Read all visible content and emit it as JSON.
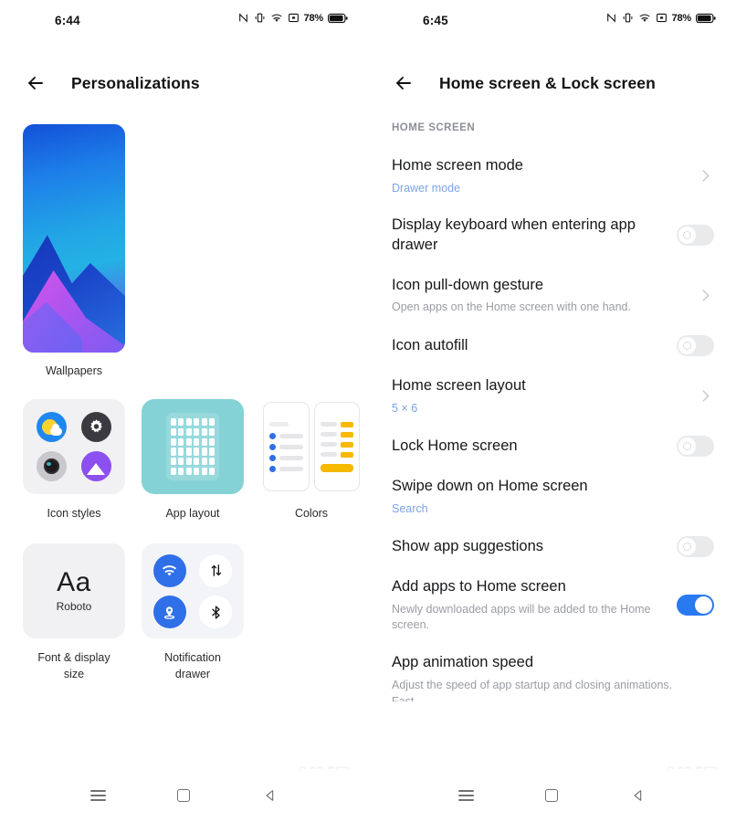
{
  "left": {
    "status": {
      "time": "6:44",
      "battery_percent": "78%",
      "icons": [
        "nfc-icon",
        "vibrate-icon",
        "wifi-icon",
        "screen-record-icon",
        "battery-icon"
      ]
    },
    "appbar": {
      "title": "Personalizations",
      "back": "back-arrow-icon"
    },
    "cards": {
      "wallpapers": {
        "label": "Wallpapers"
      },
      "icon_styles": {
        "label": "Icon styles",
        "icons": [
          "weather-icon",
          "settings-gear-icon",
          "camera-icon",
          "gallery-icon"
        ]
      },
      "app_layout": {
        "label": "App layout",
        "grid_cols": 6,
        "grid_rows": 6
      },
      "colors": {
        "label": "Colors",
        "accent": "#f6b900",
        "secondary": "#2f6fe8"
      },
      "font_display": {
        "label_line1": "Font & display",
        "label_line2": "size",
        "sample": "Aa",
        "font_name": "Roboto"
      },
      "notification_drawer": {
        "label_line1": "Notification",
        "label_line2": "drawer",
        "toggles": [
          "wifi-icon",
          "mobile-data-icon",
          "location-icon",
          "bluetooth-icon"
        ],
        "active": [
          "wifi-icon",
          "location-icon"
        ]
      }
    },
    "navbar": [
      "recents-icon",
      "home-icon",
      "back-icon"
    ],
    "watermark_line1": "NYP",
    "watermark_line2": "GKS"
  },
  "right": {
    "status": {
      "time": "6:45",
      "battery_percent": "78%",
      "icons": [
        "nfc-icon",
        "vibrate-icon",
        "wifi-icon",
        "screen-record-icon",
        "battery-icon"
      ]
    },
    "appbar": {
      "title": "Home screen & Lock screen",
      "back": "back-arrow-icon"
    },
    "section_header": "HOME SCREEN",
    "rows": [
      {
        "title": "Home screen mode",
        "value": "Drawer mode",
        "control": "chevron"
      },
      {
        "title": "Display keyboard when entering app drawer",
        "control": "toggle",
        "toggle_on": false
      },
      {
        "title": "Icon pull-down gesture",
        "sub": "Open apps on the Home screen with one hand.",
        "control": "chevron"
      },
      {
        "title": "Icon autofill",
        "control": "toggle",
        "toggle_on": false
      },
      {
        "title": "Home screen layout",
        "value": "5 × 6",
        "control": "chevron"
      },
      {
        "title": "Lock Home screen",
        "control": "toggle",
        "toggle_on": false
      },
      {
        "title": "Swipe down on Home screen",
        "value": "Search",
        "control": "chevron"
      },
      {
        "title": "Show app suggestions",
        "control": "toggle",
        "toggle_on": false
      },
      {
        "title": "Add apps to Home screen",
        "sub": "Newly downloaded apps will be added to the Home screen.",
        "control": "toggle",
        "toggle_on": true
      },
      {
        "title": "App animation speed",
        "sub": "Adjust the speed of app startup and closing animations.",
        "value_cut": "Fast",
        "control": "none"
      }
    ],
    "navbar": [
      "recents-icon",
      "home-icon",
      "back-icon"
    ],
    "watermark_line1": "NYP",
    "watermark_line2": "GKS"
  }
}
